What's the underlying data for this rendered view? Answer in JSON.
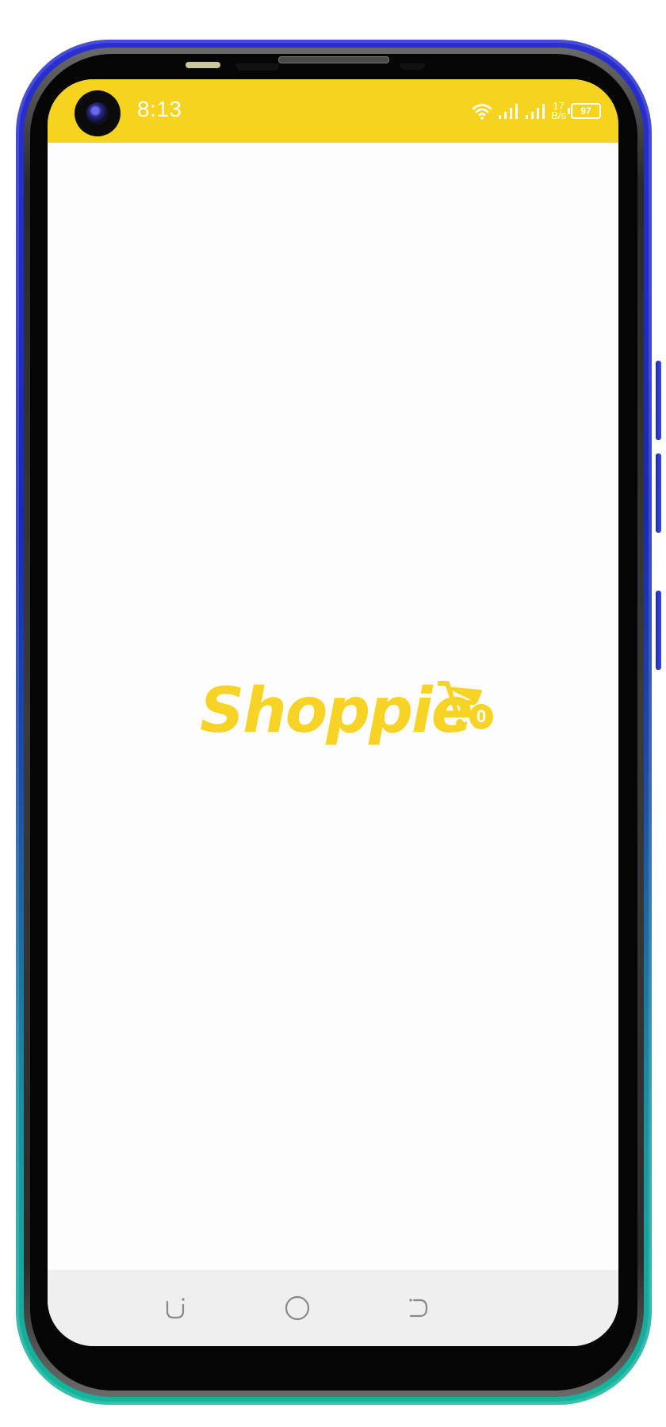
{
  "status_bar": {
    "time": "8:13",
    "network_speed_value": "17",
    "network_speed_unit": "B/s",
    "battery_level": "97"
  },
  "splash": {
    "brand_name": "Shoppie",
    "cart_count": "0",
    "brand_color": "#f6d324"
  },
  "nav": {
    "recent_icon": "recent-apps-icon",
    "home_icon": "home-icon",
    "back_icon": "back-icon"
  },
  "colors": {
    "status_bar_bg": "#f5d31f",
    "screen_bg": "#fdfdfd",
    "nav_bg": "#efefef"
  }
}
